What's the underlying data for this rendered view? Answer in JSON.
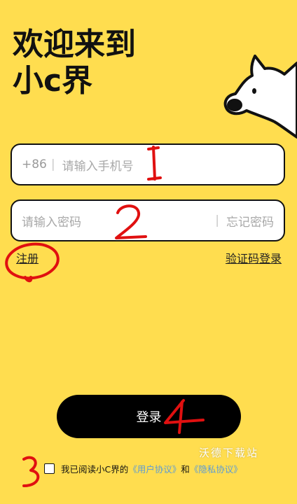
{
  "welcome": {
    "line1": "欢迎来到",
    "line2": "小c界"
  },
  "phone": {
    "prefix": "+86",
    "separator": "|",
    "placeholder": "请输入手机号"
  },
  "password": {
    "placeholder": "请输入密码",
    "separator": "|",
    "forgot_label": "忘记密码"
  },
  "links": {
    "register": "注册",
    "code_login": "验证码登录"
  },
  "login_button": "登录",
  "agreement": {
    "prefix": "我已阅读小C界的",
    "user_policy": "《用户协议》",
    "and": "和",
    "privacy_policy": "《隐私协议》",
    "checked": false
  },
  "watermark": "沃德下载站",
  "annotations": {
    "n1": "1",
    "n2": "2",
    "n3": "3",
    "n4": "4",
    "color": "#E01010"
  },
  "colors": {
    "background": "#FFDD4F",
    "button": "#000000",
    "link_blue": "#5B9BD5"
  }
}
